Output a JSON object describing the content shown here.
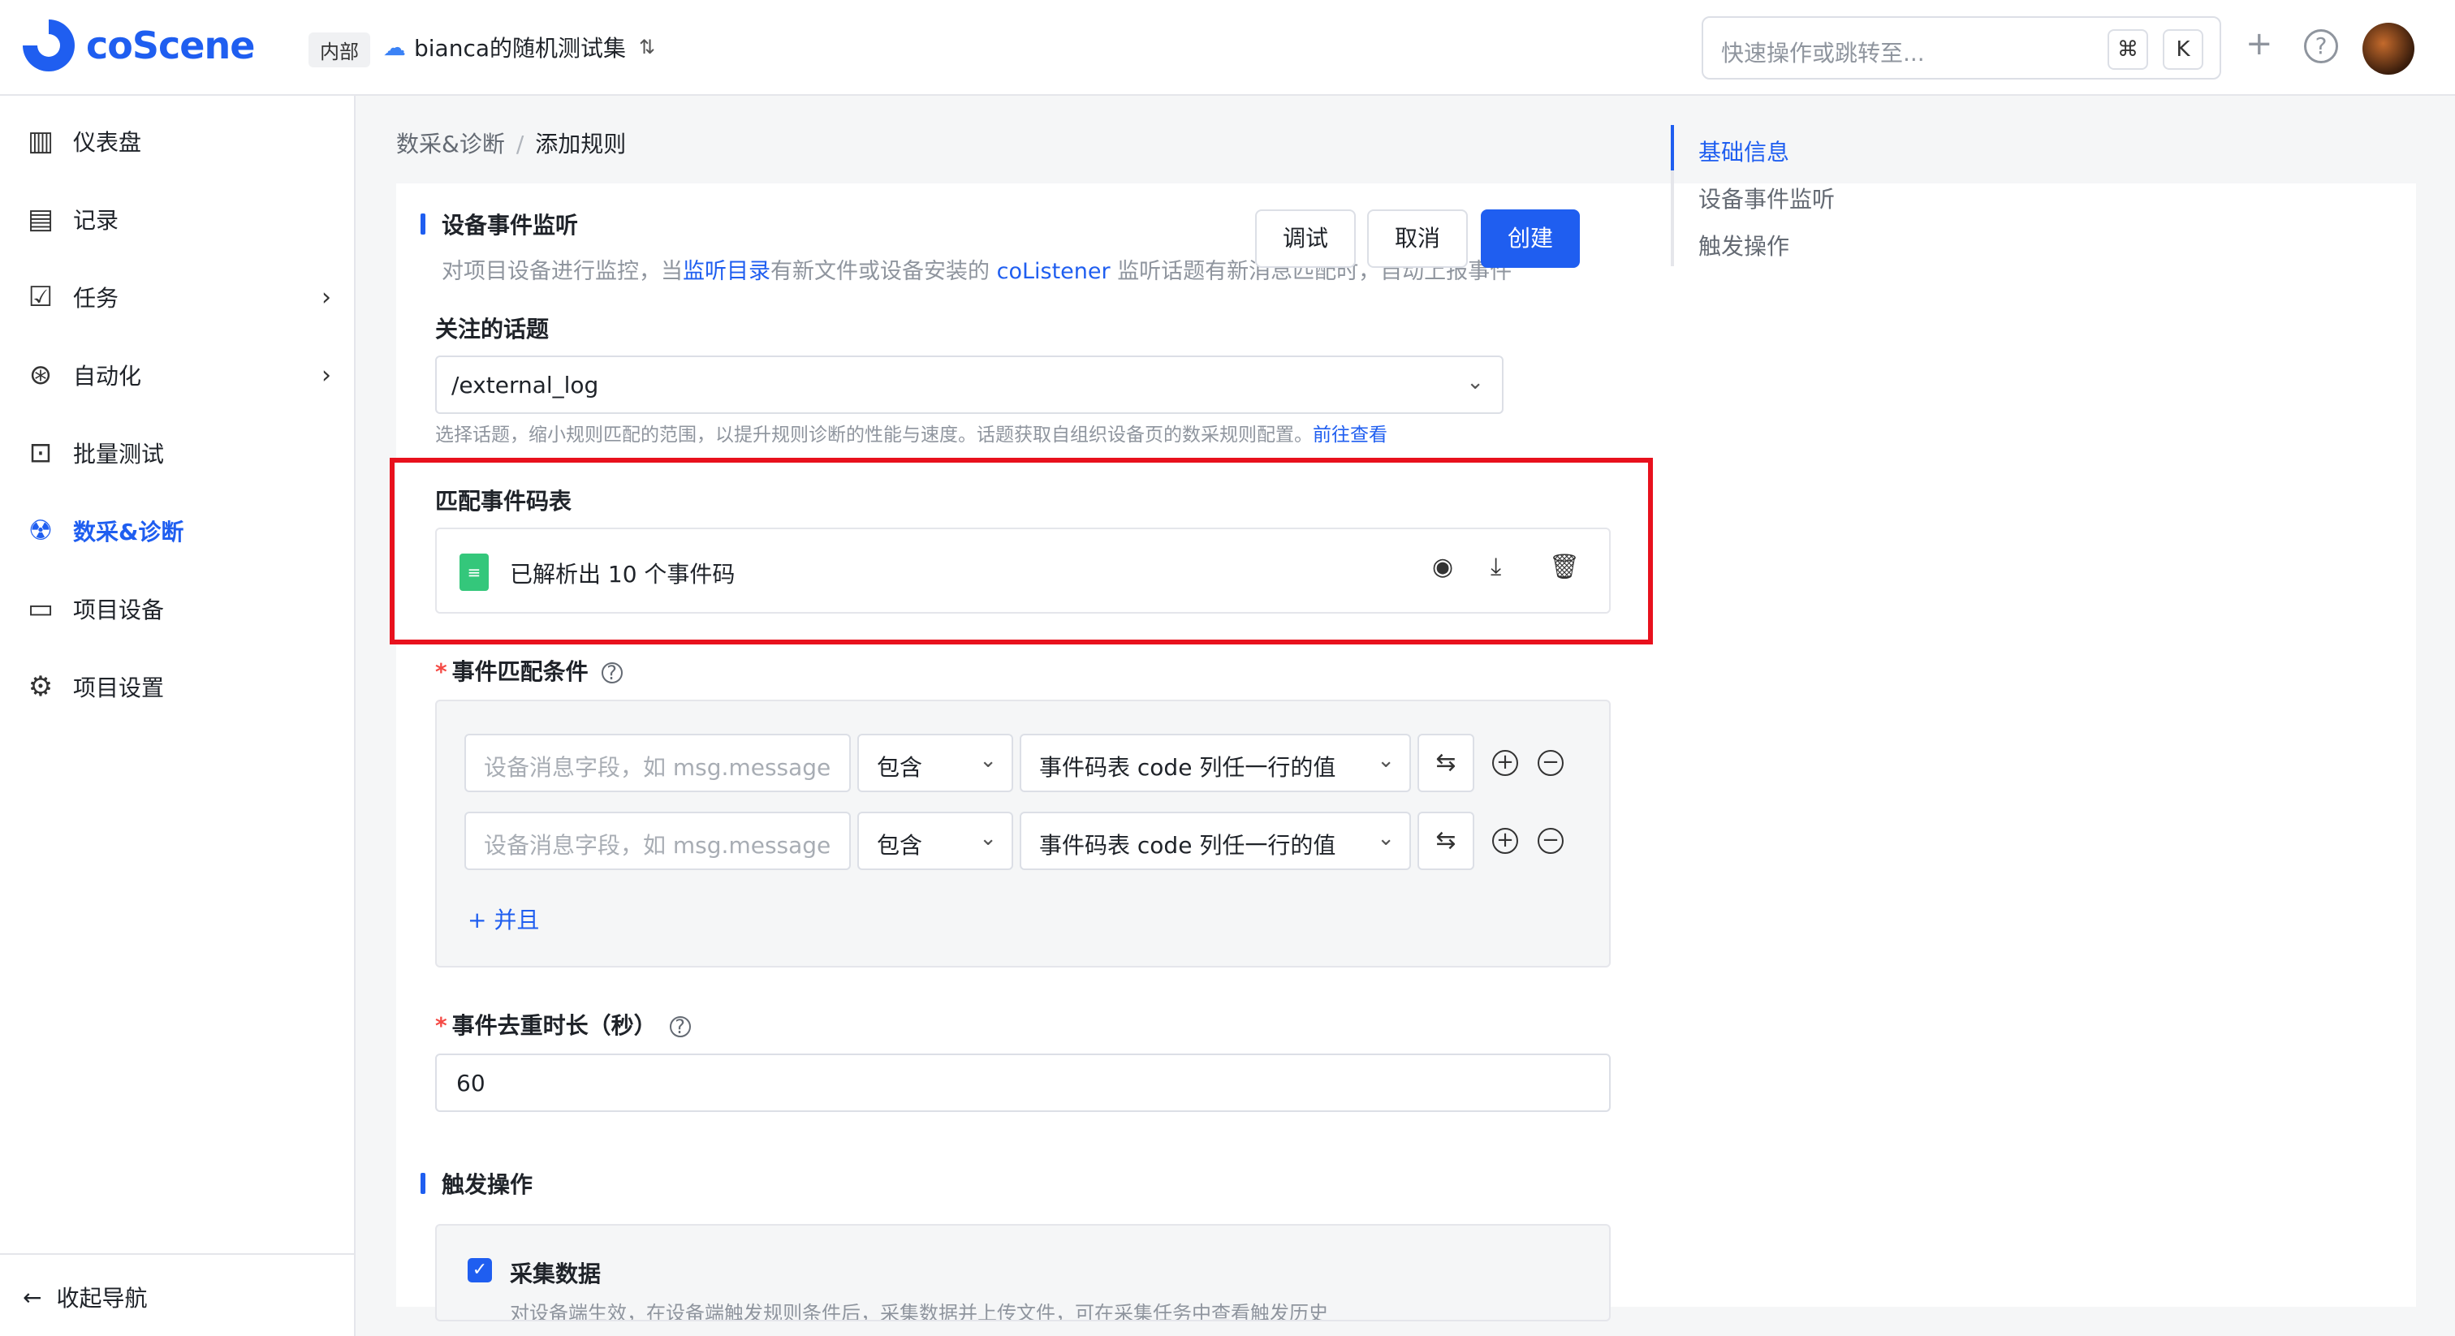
{
  "header": {
    "brand": "coScene",
    "tag": "内部",
    "project": "bianca的随机测试集",
    "search_placeholder": "快速操作或跳转至...",
    "shortcut_cmd": "⌘",
    "shortcut_key": "K"
  },
  "sidebar": {
    "items": [
      {
        "label": "仪表盘",
        "icon": "dashboard-icon"
      },
      {
        "label": "记录",
        "icon": "record-icon"
      },
      {
        "label": "任务",
        "icon": "task-icon"
      },
      {
        "label": "自动化",
        "icon": "automation-icon"
      },
      {
        "label": "批量测试",
        "icon": "batch-test-icon"
      },
      {
        "label": "数采&诊断",
        "icon": "data-diagnosis-icon",
        "active": true
      },
      {
        "label": "项目设备",
        "icon": "device-icon"
      },
      {
        "label": "项目设置",
        "icon": "settings-icon"
      }
    ],
    "collapse": "收起导航"
  },
  "breadcrumb": {
    "parent": "数采&诊断",
    "separator": "/",
    "current": "添加规则"
  },
  "form": {
    "section_device": "设备事件监听",
    "desc_prefix": "对项目设备进行监控，当",
    "desc_link1": "监听目录",
    "desc_mid": "有新文件或设备安装的",
    "desc_link2": "coListener",
    "desc_suffix": "监听话题有新消息匹配时，自动上报事件",
    "topic_label": "关注的话题",
    "topic_value": "/external_log",
    "topic_hint": "选择话题，缩小规则匹配的范围，以提升规则诊断的性能与速度。话题获取自组织设备页的数采规则配置。",
    "topic_hint_link": "前往查看",
    "codes_label": "匹配事件码表",
    "codes_file": "已解析出 10 个事件码",
    "cond_label": "事件匹配条件",
    "conditions": [
      {
        "field_placeholder": "设备消息字段，如 msg.message",
        "op": "包含",
        "value": "事件码表 code 列任一行的值"
      },
      {
        "field_placeholder": "设备消息字段，如 msg.message",
        "op": "包含",
        "value": "事件码表 code 列任一行的值"
      }
    ],
    "and_button": "+ 并且",
    "dedup_label": "事件去重时长（秒）",
    "dedup_value": "60",
    "section_trigger": "触发操作",
    "collect_label": "采集数据",
    "collect_desc": "对设备端生效，在设备端触发规则条件后，采集数据并上传文件，可在采集任务中查看触发历史"
  },
  "actions": {
    "debug": "调试",
    "cancel": "取消",
    "create": "创建"
  },
  "anchor_nav": [
    "基础信息",
    "设备事件监听",
    "触发操作"
  ],
  "colors": {
    "primary": "#1f5ef0",
    "highlight": "#e8111d",
    "required": "#f54a45"
  }
}
